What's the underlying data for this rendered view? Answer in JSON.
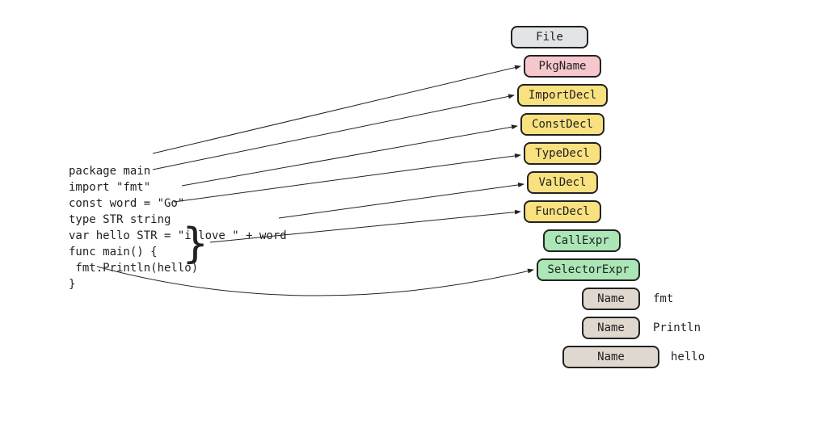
{
  "code": {
    "l1": "package main",
    "l2": "import \"fmt\"",
    "l3": "const word = \"Go\"",
    "l4": "type STR string",
    "l5": "var hello STR = \"i love \" + word",
    "l6": "func main() {",
    "l7": " fmt.Println(hello)",
    "l8": "}"
  },
  "brace": "}",
  "nodes": {
    "file": "File",
    "pkgname": "PkgName",
    "importdecl": "ImportDecl",
    "constdecl": "ConstDecl",
    "typedecl": "TypeDecl",
    "valdecl": "ValDecl",
    "funcdecl": "FuncDecl",
    "callexpr": "CallExpr",
    "selectorexpr": "SelectorExpr",
    "name1": "Name",
    "name2": "Name",
    "name3": "Name"
  },
  "labels": {
    "fmt": "fmt",
    "println": "Println",
    "hello": "hello"
  }
}
